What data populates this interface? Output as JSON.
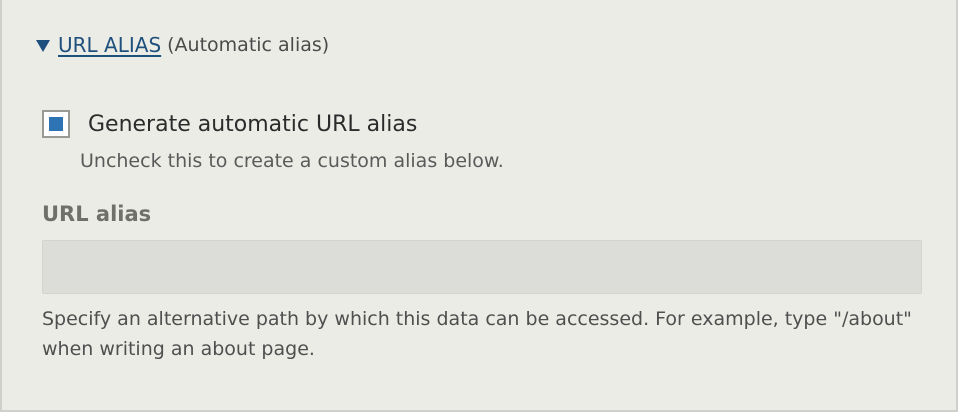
{
  "section": {
    "title_link": "URL ALIAS",
    "title_note": "(Automatic alias)",
    "expanded_icon": "triangle-down-icon"
  },
  "auto_alias": {
    "checked": true,
    "label": "Generate automatic URL alias",
    "description": "Uncheck this to create a custom alias below.",
    "accent_color": "#2e74b5"
  },
  "url_alias_field": {
    "label": "URL alias",
    "value": "",
    "placeholder": "",
    "disabled": true,
    "description": "Specify an alternative path by which this data can be accessed. For example, type \"/about\" when writing an about page."
  }
}
